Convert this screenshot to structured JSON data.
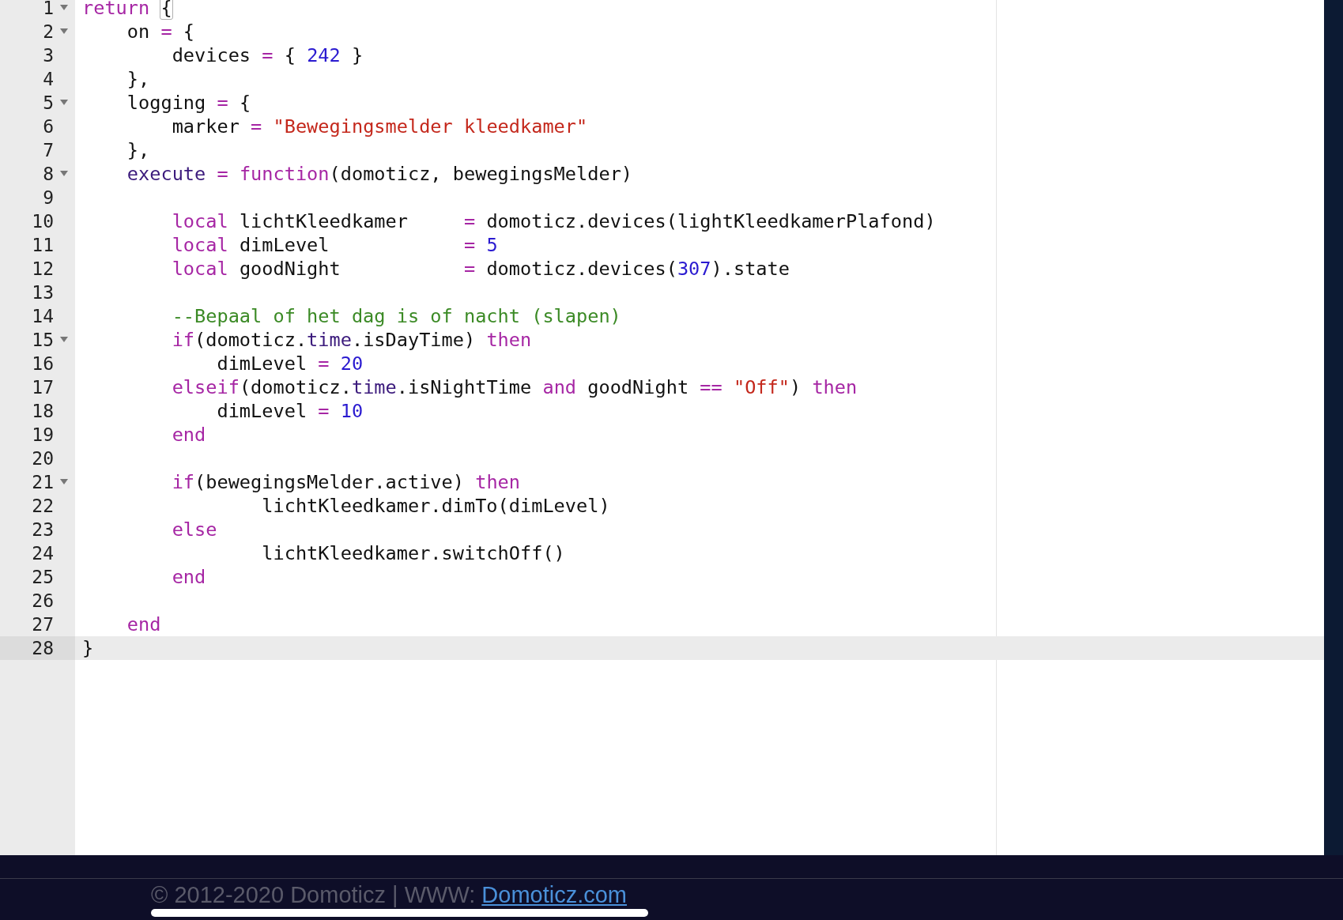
{
  "editor": {
    "lines": [
      {
        "number": "1",
        "foldable": true,
        "active": false,
        "tokens": [
          {
            "kind": "keyword",
            "text": "return "
          },
          {
            "kind": "bracket-match",
            "text": "{"
          }
        ]
      },
      {
        "number": "2",
        "foldable": true,
        "active": false,
        "tokens": [
          {
            "kind": "plain",
            "text": "    on "
          },
          {
            "kind": "operator",
            "text": "="
          },
          {
            "kind": "plain",
            "text": " {"
          }
        ]
      },
      {
        "number": "3",
        "foldable": false,
        "active": false,
        "tokens": [
          {
            "kind": "plain",
            "text": "        devices "
          },
          {
            "kind": "operator",
            "text": "="
          },
          {
            "kind": "plain",
            "text": " { "
          },
          {
            "kind": "number",
            "text": "242"
          },
          {
            "kind": "plain",
            "text": " }"
          }
        ]
      },
      {
        "number": "4",
        "foldable": false,
        "active": false,
        "tokens": [
          {
            "kind": "plain",
            "text": "    },"
          }
        ]
      },
      {
        "number": "5",
        "foldable": true,
        "active": false,
        "tokens": [
          {
            "kind": "plain",
            "text": "    logging "
          },
          {
            "kind": "operator",
            "text": "="
          },
          {
            "kind": "plain",
            "text": " {"
          }
        ]
      },
      {
        "number": "6",
        "foldable": false,
        "active": false,
        "tokens": [
          {
            "kind": "plain",
            "text": "        marker "
          },
          {
            "kind": "operator",
            "text": "= "
          },
          {
            "kind": "string",
            "text": "\"Bewegingsmelder kleedkamer\""
          }
        ]
      },
      {
        "number": "7",
        "foldable": false,
        "active": false,
        "tokens": [
          {
            "kind": "plain",
            "text": "    },"
          }
        ]
      },
      {
        "number": "8",
        "foldable": true,
        "active": false,
        "tokens": [
          {
            "kind": "variable",
            "text": "    execute "
          },
          {
            "kind": "operator",
            "text": "= "
          },
          {
            "kind": "keyword",
            "text": "function"
          },
          {
            "kind": "plain",
            "text": "(domoticz, bewegingsMelder)"
          }
        ]
      },
      {
        "number": "9",
        "foldable": false,
        "active": false
      },
      {
        "number": "10",
        "foldable": false,
        "active": false,
        "tokens": [
          {
            "kind": "keyword",
            "text": "        local"
          },
          {
            "kind": "plain",
            "text": " lichtKleedkamer     "
          },
          {
            "kind": "operator",
            "text": "="
          },
          {
            "kind": "plain",
            "text": " domoticz.devices(lightKleedkamerPlafond)"
          }
        ]
      },
      {
        "number": "11",
        "foldable": false,
        "active": false,
        "tokens": [
          {
            "kind": "keyword",
            "text": "        local"
          },
          {
            "kind": "plain",
            "text": " dimLevel            "
          },
          {
            "kind": "operator",
            "text": "= "
          },
          {
            "kind": "number",
            "text": "5"
          }
        ]
      },
      {
        "number": "12",
        "foldable": false,
        "active": false,
        "tokens": [
          {
            "kind": "keyword",
            "text": "        local"
          },
          {
            "kind": "plain",
            "text": " goodNight           "
          },
          {
            "kind": "operator",
            "text": "="
          },
          {
            "kind": "plain",
            "text": " domoticz.devices("
          },
          {
            "kind": "number",
            "text": "307"
          },
          {
            "kind": "plain",
            "text": ").state"
          }
        ]
      },
      {
        "number": "13",
        "foldable": false,
        "active": false
      },
      {
        "number": "14",
        "foldable": false,
        "active": false,
        "tokens": [
          {
            "kind": "comment",
            "text": "        --Bepaal of het dag is of nacht (slapen)"
          }
        ]
      },
      {
        "number": "15",
        "foldable": true,
        "active": false,
        "tokens": [
          {
            "kind": "keyword",
            "text": "        if"
          },
          {
            "kind": "plain",
            "text": "(domoticz."
          },
          {
            "kind": "variable",
            "text": "time"
          },
          {
            "kind": "plain",
            "text": ".isDayTime) "
          },
          {
            "kind": "keyword",
            "text": "then"
          }
        ]
      },
      {
        "number": "16",
        "foldable": false,
        "active": false,
        "tokens": [
          {
            "kind": "plain",
            "text": "            dimLevel "
          },
          {
            "kind": "operator",
            "text": "= "
          },
          {
            "kind": "number",
            "text": "20"
          }
        ]
      },
      {
        "number": "17",
        "foldable": false,
        "active": false,
        "tokens": [
          {
            "kind": "keyword",
            "text": "        elseif"
          },
          {
            "kind": "plain",
            "text": "(domoticz."
          },
          {
            "kind": "variable",
            "text": "time"
          },
          {
            "kind": "plain",
            "text": ".isNightTime "
          },
          {
            "kind": "keyword",
            "text": "and"
          },
          {
            "kind": "plain",
            "text": " goodNight "
          },
          {
            "kind": "operator",
            "text": "== "
          },
          {
            "kind": "string",
            "text": "\"Off\""
          },
          {
            "kind": "plain",
            "text": ") "
          },
          {
            "kind": "keyword",
            "text": "then"
          }
        ]
      },
      {
        "number": "18",
        "foldable": false,
        "active": false,
        "tokens": [
          {
            "kind": "plain",
            "text": "            dimLevel "
          },
          {
            "kind": "operator",
            "text": "= "
          },
          {
            "kind": "number",
            "text": "10"
          }
        ]
      },
      {
        "number": "19",
        "foldable": false,
        "active": false,
        "tokens": [
          {
            "kind": "keyword",
            "text": "        end"
          }
        ]
      },
      {
        "number": "20",
        "foldable": false,
        "active": false
      },
      {
        "number": "21",
        "foldable": true,
        "active": false,
        "tokens": [
          {
            "kind": "keyword",
            "text": "        if"
          },
          {
            "kind": "plain",
            "text": "(bewegingsMelder.active) "
          },
          {
            "kind": "keyword",
            "text": "then"
          }
        ]
      },
      {
        "number": "22",
        "foldable": false,
        "active": false,
        "tokens": [
          {
            "kind": "plain",
            "text": "                lichtKleedkamer.dimTo(dimLevel)"
          }
        ]
      },
      {
        "number": "23",
        "foldable": false,
        "active": false,
        "tokens": [
          {
            "kind": "keyword",
            "text": "        else"
          }
        ]
      },
      {
        "number": "24",
        "foldable": false,
        "active": false,
        "tokens": [
          {
            "kind": "plain",
            "text": "                lichtKleedkamer.switchOff()"
          }
        ]
      },
      {
        "number": "25",
        "foldable": false,
        "active": false,
        "tokens": [
          {
            "kind": "keyword",
            "text": "        end"
          }
        ]
      },
      {
        "number": "26",
        "foldable": false,
        "active": false
      },
      {
        "number": "27",
        "foldable": false,
        "active": false,
        "tokens": [
          {
            "kind": "keyword",
            "text": "    end"
          }
        ]
      },
      {
        "number": "28",
        "foldable": false,
        "active": true,
        "tokens": [
          {
            "kind": "plain",
            "text": "}"
          }
        ]
      }
    ]
  },
  "footer": {
    "copyright": "© 2012-2020 Domoticz | WWW:",
    "link": "Domoticz.com"
  }
}
